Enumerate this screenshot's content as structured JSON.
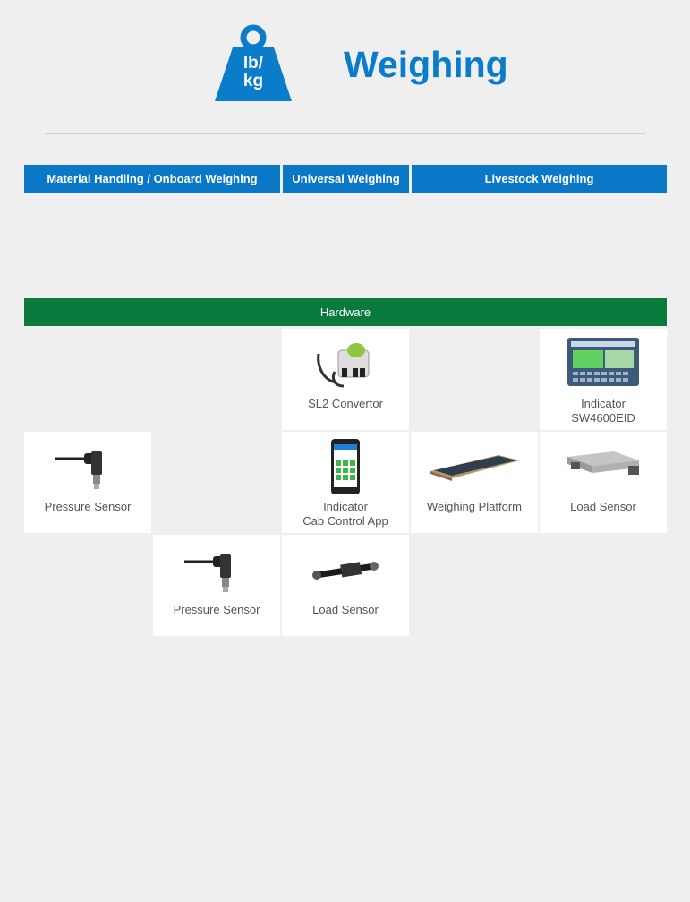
{
  "header": {
    "icon_name": "weight-lb-kg-icon",
    "icon_text_line1": "lb/",
    "icon_text_line2": "kg",
    "title": "Weighing",
    "accent_color": "#0a7cc9"
  },
  "tabs": [
    {
      "label": "Material Handling / Onboard Weighing"
    },
    {
      "label": "Universal Weighing"
    },
    {
      "label": "Livestock Weighing"
    }
  ],
  "hardware": {
    "label": "Hardware",
    "color": "#0a7a3c"
  },
  "products": [
    {
      "name": "SL2 Convertor",
      "icon": "sl2-convertor-icon"
    },
    {
      "name_line1": "Indicator",
      "name_line2": "SW4600EID",
      "icon": "indicator-sw4600eid-icon"
    },
    {
      "name": "Pressure Sensor",
      "icon": "pressure-sensor-icon"
    },
    {
      "name_line1": "Indicator",
      "name_line2": "Cab Control App",
      "icon": "smartphone-app-icon"
    },
    {
      "name": "Weighing Platform",
      "icon": "weighing-platform-icon"
    },
    {
      "name": "Load Sensor",
      "icon": "load-bar-icon"
    },
    {
      "name": "Pressure Sensor",
      "icon": "pressure-sensor-icon"
    },
    {
      "name": "Load Sensor",
      "icon": "load-cell-icon"
    }
  ]
}
